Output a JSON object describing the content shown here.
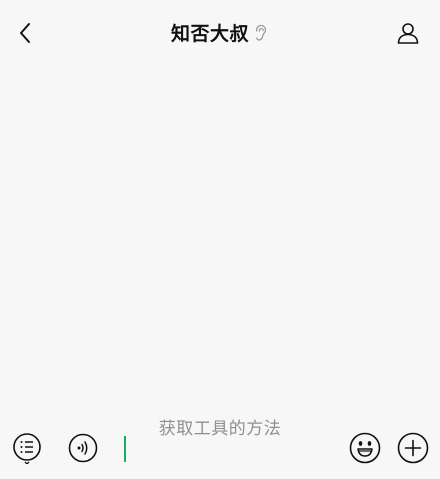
{
  "header": {
    "title": "知否大叔"
  },
  "icons": {
    "back": "chevron-left-icon",
    "ear": "ear-icon",
    "profile": "person-icon",
    "menu": "list-icon",
    "voice": "voice-icon",
    "emoji": "smiley-icon",
    "plus": "plus-icon"
  },
  "input_bar": {
    "hint": "获取工具的方法",
    "caret_color": "#1aad5a"
  },
  "colors": {
    "background": "#f7f7f7",
    "icon": "#111111",
    "hint": "#8f8f8f"
  }
}
